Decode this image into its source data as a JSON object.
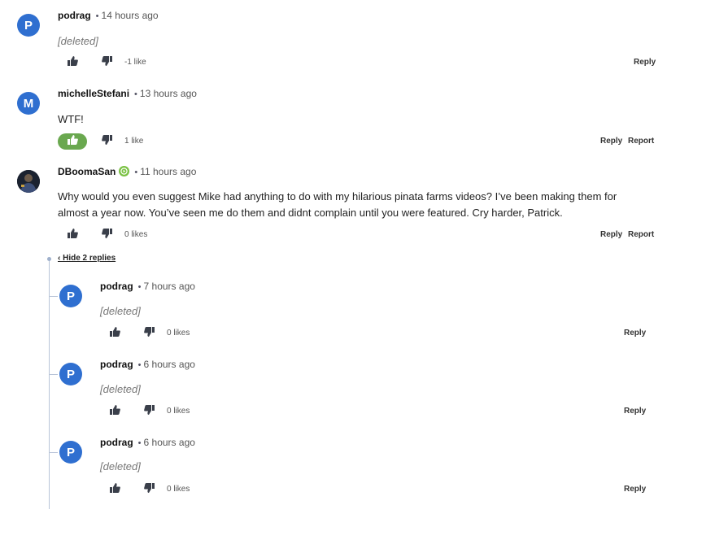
{
  "comments": [
    {
      "author": "podrag",
      "avatar_letter": "P",
      "time": "14 hours ago",
      "body": "[deleted]",
      "likes": "-1 like",
      "reply": "Reply"
    },
    {
      "author": "michelleStefani",
      "avatar_letter": "M",
      "time": "13 hours ago",
      "body": "WTF!",
      "likes": "1 like",
      "reply": "Reply",
      "report": "Report"
    },
    {
      "author": "DBoomaSan",
      "time": "11 hours ago",
      "body_lines": [
        "Why would you even suggest Mike had anything to do with my hilarious pinata farms videos? I’ve been making them for",
        "almost a year now. You’ve seen me do them and didnt complain until you were featured. Cry harder, Patrick."
      ],
      "likes": "0 likes",
      "reply": "Reply",
      "report": "Report"
    }
  ],
  "hide_replies_label": "‹ Hide 2 replies",
  "replies": [
    {
      "author": "podrag",
      "avatar_letter": "P",
      "time": "7 hours ago",
      "body": "[deleted]",
      "likes": "0 likes",
      "reply": "Reply"
    },
    {
      "author": "podrag",
      "avatar_letter": "P",
      "time": "6 hours ago",
      "body": "[deleted]",
      "likes": "0 likes",
      "reply": "Reply"
    },
    {
      "author": "podrag",
      "avatar_letter": "P",
      "time": "6 hours ago",
      "body": "[deleted]",
      "likes": "0 likes",
      "reply": "Reply"
    }
  ],
  "icons": {
    "upvote": "thumbs-up-icon",
    "downvote": "thumbs-down-icon",
    "badge": "play-badge-icon"
  },
  "colors": {
    "avatar": "#2f6fd0",
    "upvote_active": "#6aa84f",
    "badge": "#7ac143"
  }
}
